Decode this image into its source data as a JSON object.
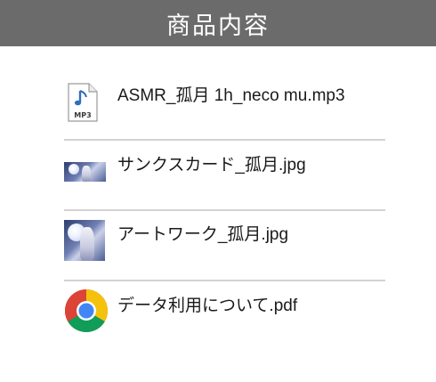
{
  "header": {
    "title": "商品内容"
  },
  "files": [
    {
      "name": "ASMR_孤月 1h_neco mu.mp3",
      "icon": "mp3-file-icon",
      "icon_label": "MP3"
    },
    {
      "name": "サンクスカード_孤月.jpg",
      "icon": "thumbnail-image-icon"
    },
    {
      "name": "アートワーク_孤月.jpg",
      "icon": "thumbnail-image-icon"
    },
    {
      "name": "データ利用について.pdf",
      "icon": "chrome-icon"
    }
  ],
  "colors": {
    "header_bg": "#6b6b6b",
    "divider": "#d2d2d2",
    "mp3_note": "#2f6fc0",
    "chrome_red": "#db4437",
    "chrome_yellow": "#f4c20d",
    "chrome_green": "#0f9d58",
    "chrome_blue": "#4285f4"
  }
}
